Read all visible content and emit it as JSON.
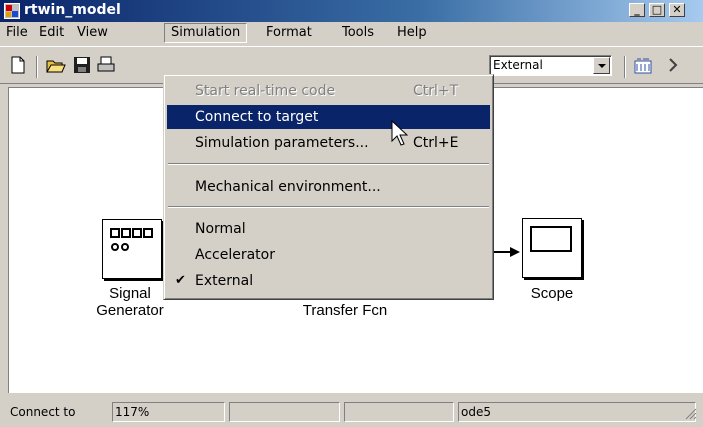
{
  "window": {
    "title": "rtwin_model"
  },
  "menubar": {
    "items": [
      "File",
      "Edit",
      "View",
      "Simulation",
      "Format",
      "Tools",
      "Help"
    ]
  },
  "toolbar": {
    "mode_value": "External"
  },
  "simulation_menu": {
    "items": [
      {
        "label": "Start real-time code",
        "shortcut": "Ctrl+T",
        "state": "disabled"
      },
      {
        "label": "Connect to target",
        "shortcut": "",
        "state": "highlighted"
      },
      {
        "label": "Simulation parameters...",
        "shortcut": "Ctrl+E",
        "state": "normal"
      },
      {
        "label": "Mechanical environment...",
        "shortcut": "",
        "state": "normal"
      },
      {
        "label": "Normal",
        "shortcut": "",
        "state": "normal"
      },
      {
        "label": "Accelerator",
        "shortcut": "",
        "state": "normal"
      },
      {
        "label": "External",
        "shortcut": "",
        "state": "checked"
      }
    ]
  },
  "canvas": {
    "blocks": {
      "signal_generator": {
        "label_line1": "Signal",
        "label_line2": "Generator"
      },
      "transfer_fcn": {
        "label": "Transfer Fcn"
      },
      "scope": {
        "label": "Scope"
      }
    }
  },
  "statusbar": {
    "message": "Connect to",
    "zoom": "117%",
    "solver": "ode5"
  },
  "colors": {
    "title_bar": "#0a246a",
    "menu_highlight": "#0a246a",
    "chrome": "#d4d0c8",
    "canvas": "#ffffff"
  }
}
